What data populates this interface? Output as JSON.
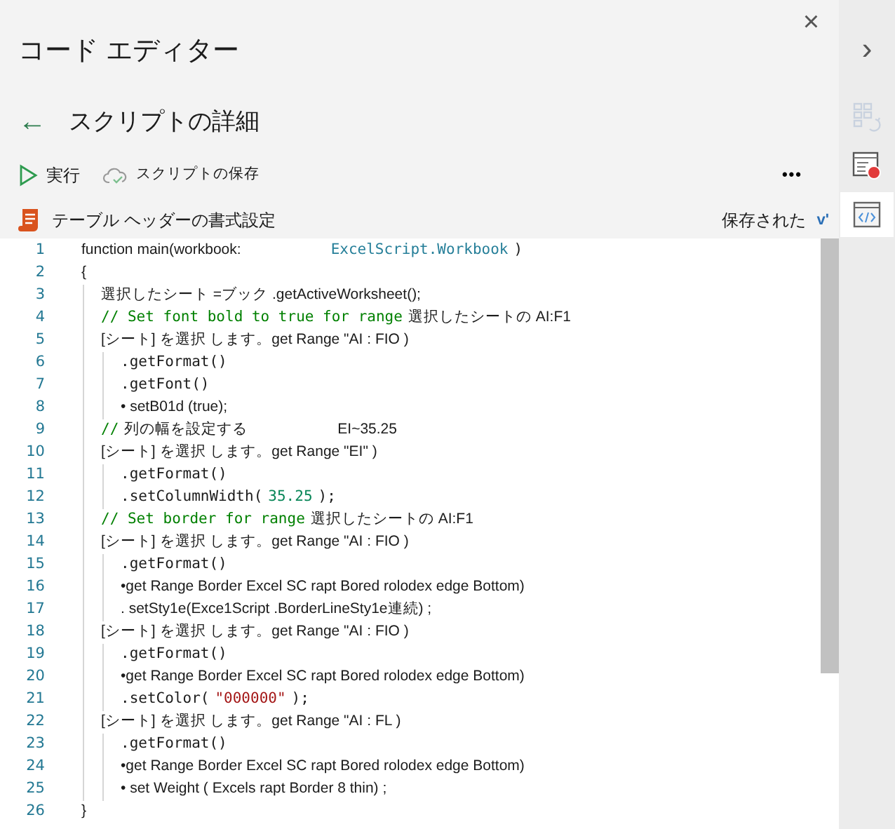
{
  "panel": {
    "title": "コード エディター",
    "close": "×"
  },
  "header": {
    "back": "←",
    "title": "スクリプトの詳細"
  },
  "toolbar": {
    "run": "実行",
    "save": "スクリプトの保存",
    "more": "•••"
  },
  "script": {
    "name": "テーブル ヘッダーの書式設定",
    "status": "保存された",
    "status_mark": "v'"
  },
  "code": {
    "lines": [
      {
        "number": "1",
        "segments": [
          {
            "kind": "text",
            "text": "function main(workbook:"
          },
          {
            "kind": "type",
            "text": "ExcelScript.Workbook",
            "aside": true
          },
          {
            "kind": "code",
            "text": ")"
          }
        ]
      },
      {
        "number": "2",
        "segments": [
          {
            "kind": "text",
            "text": "{"
          }
        ],
        "children": [
          {
            "number": "3",
            "segments": [
              {
                "kind": "text",
                "text": "選択したシート =ブック .getActiveWorksheet();"
              }
            ]
          },
          {
            "number": "4",
            "segments": [
              {
                "kind": "comment",
                "text": "// Set font bold to true for range"
              },
              {
                "kind": "text",
                "text": "選択したシートの AI:F1"
              }
            ]
          },
          {
            "number": "5",
            "segments": [
              {
                "kind": "text",
                "text": "[シート] を選択 します。get Range \"AI : FIO )"
              }
            ],
            "children": [
              {
                "number": "6",
                "segments": [
                  {
                    "kind": "code",
                    "text": ".getFormat()"
                  }
                ]
              },
              {
                "number": "7",
                "segments": [
                  {
                    "kind": "code",
                    "text": ".getFont()"
                  }
                ]
              },
              {
                "number": "8",
                "segments": [
                  {
                    "kind": "text",
                    "text": "• setB01d (true);"
                  }
                ]
              }
            ]
          },
          {
            "number": "9",
            "segments": [
              {
                "kind": "comment",
                "text": "//"
              },
              {
                "kind": "text",
                "text": "列の幅を設定する"
              },
              {
                "kind": "text",
                "text": "EI~35.25",
                "aside": true
              }
            ]
          },
          {
            "number": "10",
            "segments": [
              {
                "kind": "text",
                "text": "[シート] を選択 します。get Range \"EI\" )"
              }
            ],
            "children": [
              {
                "number": "11",
                "segments": [
                  {
                    "kind": "code",
                    "text": ".getFormat()"
                  }
                ]
              },
              {
                "number": "12",
                "segments": [
                  {
                    "kind": "code",
                    "text": ".setColumnWidth("
                  },
                  {
                    "kind": "number",
                    "text": "35.25"
                  },
                  {
                    "kind": "code",
                    "text": ");"
                  }
                ]
              }
            ]
          },
          {
            "number": "13",
            "segments": [
              {
                "kind": "comment",
                "text": "// Set border for range"
              },
              {
                "kind": "text",
                "text": "選択したシートの AI:F1"
              }
            ]
          },
          {
            "number": "14",
            "segments": [
              {
                "kind": "text",
                "text": "[シート] を選択 します。get Range \"AI : FIO )"
              }
            ],
            "children": [
              {
                "number": "15",
                "segments": [
                  {
                    "kind": "code",
                    "text": ".getFormat()"
                  }
                ]
              },
              {
                "number": "16",
                "segments": [
                  {
                    "kind": "text",
                    "text": "•get Range Border Excel SC rapt Bored rolodex edge Bottom)"
                  }
                ]
              },
              {
                "number": "17",
                "segments": [
                  {
                    "kind": "text",
                    "text": ". setSty1e(Exce1Script .BorderLineSty1e連続) ;"
                  }
                ]
              }
            ]
          },
          {
            "number": "18",
            "segments": [
              {
                "kind": "text",
                "text": "[シート] を選択 します。get Range \"AI : FIO )"
              }
            ],
            "children": [
              {
                "number": "19",
                "segments": [
                  {
                    "kind": "code",
                    "text": ".getFormat()"
                  }
                ]
              },
              {
                "number": "20",
                "segments": [
                  {
                    "kind": "text",
                    "text": "•get Range Border Excel SC rapt Bored rolodex edge Bottom)"
                  }
                ]
              },
              {
                "number": "21",
                "segments": [
                  {
                    "kind": "code",
                    "text": ".setColor("
                  },
                  {
                    "kind": "string",
                    "text": "\"000000\""
                  },
                  {
                    "kind": "code",
                    "text": ");"
                  }
                ]
              }
            ]
          },
          {
            "number": "22",
            "segments": [
              {
                "kind": "text",
                "text": "[シート] を選択 します。get Range \"AI : FL )"
              }
            ],
            "children": [
              {
                "number": "23",
                "segments": [
                  {
                    "kind": "code",
                    "text": ".getFormat()"
                  }
                ]
              },
              {
                "number": "24",
                "segments": [
                  {
                    "kind": "text",
                    "text": "•get Range Border Excel SC rapt Bored rolodex edge Bottom)"
                  }
                ]
              },
              {
                "number": "25",
                "segments": [
                  {
                    "kind": "text",
                    "text": "• set Weight ( Excels rapt Border 8 thin) ;"
                  }
                ]
              }
            ]
          }
        ]
      },
      {
        "number": "26",
        "segments": [
          {
            "kind": "text",
            "text": "}"
          }
        ]
      }
    ]
  },
  "rail": {
    "collapse": "›",
    "items": [
      {
        "kind": "grid",
        "selected": false,
        "disabled": true
      },
      {
        "kind": "record",
        "selected": false,
        "disabled": false
      },
      {
        "kind": "code",
        "selected": true,
        "disabled": false
      }
    ]
  }
}
